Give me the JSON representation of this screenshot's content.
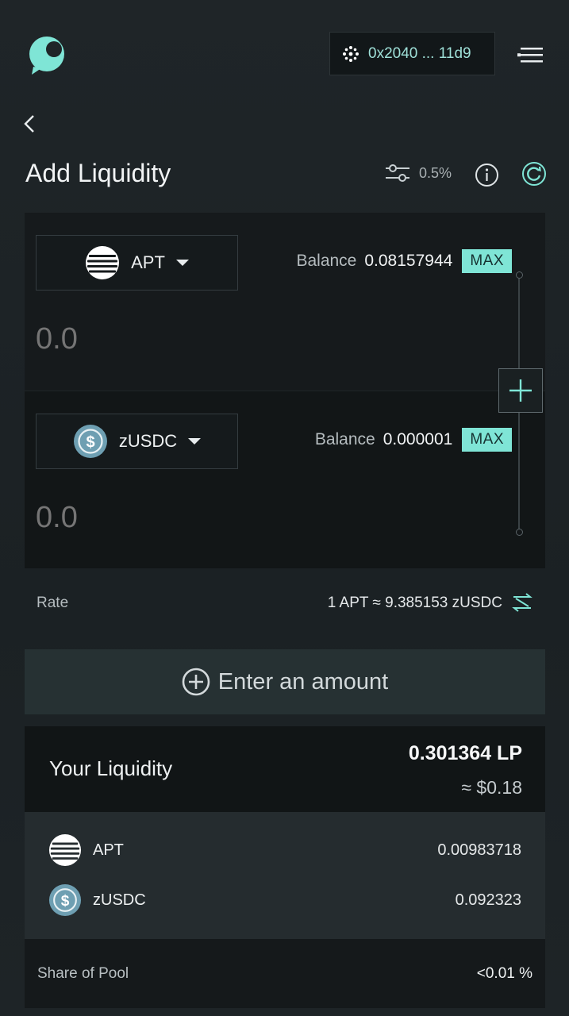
{
  "header": {
    "wallet_address": "0x2040 ... 11d9"
  },
  "page": {
    "title": "Add Liquidity",
    "slippage": "0.5%"
  },
  "token_a": {
    "symbol": "APT",
    "balance_label": "Balance",
    "balance_value": "0.08157944",
    "max_label": "MAX",
    "amount_placeholder": "0.0"
  },
  "token_b": {
    "symbol": "zUSDC",
    "balance_label": "Balance",
    "balance_value": "0.000001",
    "max_label": "MAX",
    "amount_placeholder": "0.0"
  },
  "rate": {
    "label": "Rate",
    "value": "1 APT ≈ 9.385153 zUSDC"
  },
  "action_button": {
    "label": "Enter an amount"
  },
  "your_liquidity": {
    "title": "Your Liquidity",
    "lp_amount": "0.301364 LP",
    "usd_value": "≈ $0.18",
    "positions": [
      {
        "symbol": "APT",
        "amount": "0.00983718",
        "icon": "aptos-icon"
      },
      {
        "symbol": "zUSDC",
        "amount": "0.092323",
        "icon": "usdc-icon"
      }
    ],
    "share_label": "Share of Pool",
    "share_value": "<0.01 %"
  },
  "colors": {
    "accent": "#7fe5d6",
    "background": "#1c2226",
    "card": "#131719"
  }
}
